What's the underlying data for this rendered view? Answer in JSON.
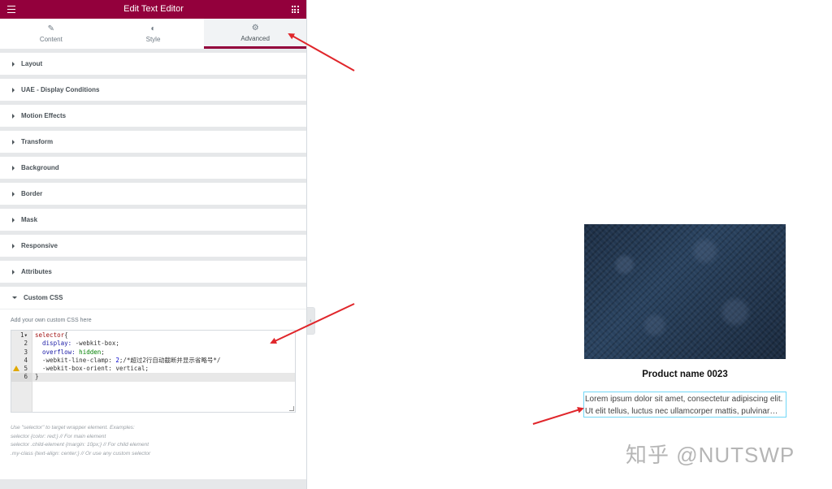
{
  "header": {
    "title": "Edit Text Editor"
  },
  "tabs": [
    {
      "label": "Content",
      "icon": "pencil-icon"
    },
    {
      "label": "Style",
      "icon": "contrast-icon"
    },
    {
      "label": "Advanced",
      "icon": "gear-icon"
    }
  ],
  "active_tab": "Advanced",
  "sections": [
    "Layout",
    "UAE - Display Conditions",
    "Motion Effects",
    "Transform",
    "Background",
    "Border",
    "Mask",
    "Responsive",
    "Attributes",
    "Custom CSS"
  ],
  "custom_css": {
    "help": "Add your own custom CSS here",
    "line_numbers": [
      "1",
      "2",
      "3",
      "4",
      "5",
      "6"
    ],
    "code": {
      "l1_sel": "selector",
      "l1_brace": "{",
      "l2_prop": "display:",
      "l2_val": " -webkit-box;",
      "l3_prop": "overflow:",
      "l3_val": " hidden",
      "l3_end": ";",
      "l4_prop": "-webkit-line-clamp:",
      "l4_num": " 2",
      "l4_rest": ";/*超过2行自动截断并显示省略号*/",
      "l5_prop": "-webkit-box-orient:",
      "l5_val": " vertical;",
      "l6": "}"
    },
    "hint_lines": [
      "Use \"selector\" to target wrapper element. Examples:",
      "selector {color: red;} // For main element",
      "selector .child-element {margin: 10px;} // For child element",
      ".my-class {text-align: center;} // Or use any custom selector"
    ]
  },
  "preview": {
    "product_name": "Product name 0023",
    "description": "Lorem ipsum dolor sit amet, consectetur adipiscing elit. Ut elit tellus, luctus nec ullamcorper mattis, pulvinar dapibus leo."
  },
  "watermark": "知乎 @NUTSWP",
  "colors": {
    "brand": "#93003c",
    "arrow": "#e0262b",
    "highlight_border": "#71d7f7"
  }
}
